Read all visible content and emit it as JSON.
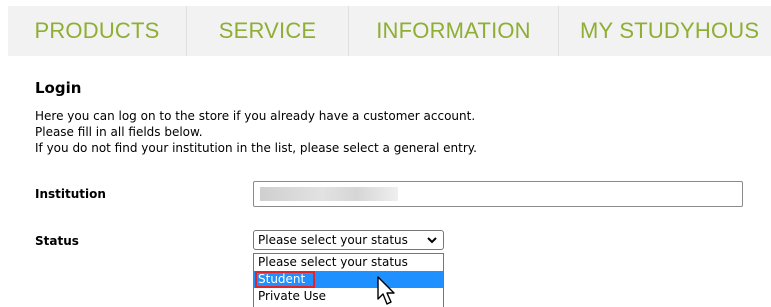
{
  "nav": {
    "items": [
      {
        "label": "PRODUCTS"
      },
      {
        "label": "SERVICE"
      },
      {
        "label": "INFORMATION"
      },
      {
        "label": "MY STUDYHOUS"
      }
    ],
    "color": "#8eae34"
  },
  "login": {
    "title": "Login",
    "intro": [
      "Here you can log on to the store if you already have a customer account.",
      "Please fill in all fields below.",
      "If you do not find your institution in the list, please select a general entry."
    ],
    "institution_label": "Institution",
    "status_label": "Status",
    "status_selected": "Please select your status",
    "status_options": [
      {
        "label": "Please select your status"
      },
      {
        "label": "Student"
      },
      {
        "label": "Private Use"
      }
    ]
  },
  "colors": {
    "selection": "#1e90ff",
    "highlight_box": "#e0242b"
  },
  "icons": {
    "dropdown": "chevron-down-icon",
    "pointer": "mouse-pointer-icon"
  }
}
